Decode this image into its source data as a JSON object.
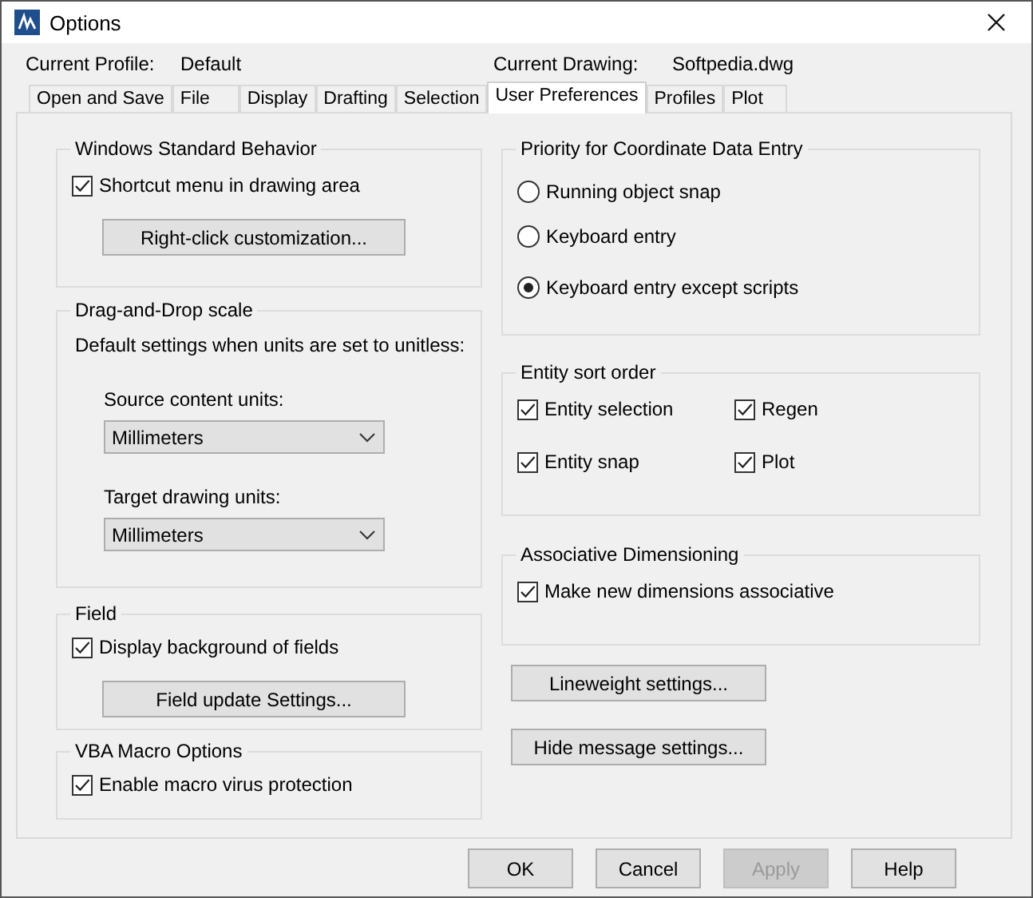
{
  "window": {
    "title": "Options"
  },
  "profile": {
    "label": "Current Profile:",
    "value": "Default"
  },
  "drawing": {
    "label": "Current Drawing:",
    "value": "Softpedia.dwg"
  },
  "tabs": [
    {
      "label": "Open and Save",
      "selected": false
    },
    {
      "label": "File",
      "selected": false
    },
    {
      "label": "Display",
      "selected": false
    },
    {
      "label": "Drafting",
      "selected": false
    },
    {
      "label": "Selection",
      "selected": false
    },
    {
      "label": "User Preferences",
      "selected": true
    },
    {
      "label": "Profiles",
      "selected": false
    },
    {
      "label": "Plot",
      "selected": false
    }
  ],
  "left": [
    {
      "kind": "group",
      "title": "Windows Standard Behavior",
      "items": [
        {
          "kind": "checkbox",
          "label": "Shortcut menu in drawing area",
          "checked": true
        },
        {
          "kind": "button",
          "label": "Right-click customization..."
        }
      ]
    },
    {
      "kind": "group",
      "title": "Drag-and-Drop scale",
      "items": [
        {
          "kind": "text",
          "label": "Default settings when units are set to unitless:"
        },
        {
          "kind": "label",
          "label": "Source content units:"
        },
        {
          "kind": "dropdown",
          "value": "Millimeters"
        },
        {
          "kind": "label",
          "label": "Target drawing units:"
        },
        {
          "kind": "dropdown",
          "value": "Millimeters"
        }
      ]
    },
    {
      "kind": "group",
      "title": "Field",
      "items": [
        {
          "kind": "checkbox",
          "label": "Display background of fields",
          "checked": true
        },
        {
          "kind": "button",
          "label": "Field update Settings..."
        }
      ]
    },
    {
      "kind": "group",
      "title": "VBA Macro Options",
      "items": [
        {
          "kind": "checkbox",
          "label": "Enable macro virus protection",
          "checked": true
        }
      ]
    }
  ],
  "right": [
    {
      "kind": "group",
      "title": "Priority for Coordinate Data Entry",
      "items": [
        {
          "kind": "radio",
          "label": "Running object snap",
          "selected": false
        },
        {
          "kind": "radio",
          "label": "Keyboard entry",
          "selected": false
        },
        {
          "kind": "radio",
          "label": "Keyboard entry except scripts",
          "selected": true
        }
      ]
    },
    {
      "kind": "grid",
      "title": "Entity sort order",
      "items": [
        {
          "kind": "checkbox",
          "label": "Entity selection",
          "checked": true
        },
        {
          "kind": "checkbox",
          "label": "Regen",
          "checked": true
        },
        {
          "kind": "checkbox",
          "label": "Entity snap",
          "checked": true
        },
        {
          "kind": "checkbox",
          "label": "Plot",
          "checked": true
        }
      ]
    },
    {
      "kind": "group",
      "title": "Associative Dimensioning",
      "items": [
        {
          "kind": "checkbox",
          "label": "Make new dimensions associative",
          "checked": true
        }
      ]
    },
    {
      "kind": "button",
      "label": "Lineweight settings..."
    },
    {
      "kind": "button",
      "label": "Hide message settings..."
    }
  ],
  "buttons": [
    {
      "label": "OK",
      "disabled": false
    },
    {
      "label": "Cancel",
      "disabled": false
    },
    {
      "label": "Apply",
      "disabled": true
    },
    {
      "label": "Help",
      "disabled": false
    }
  ]
}
